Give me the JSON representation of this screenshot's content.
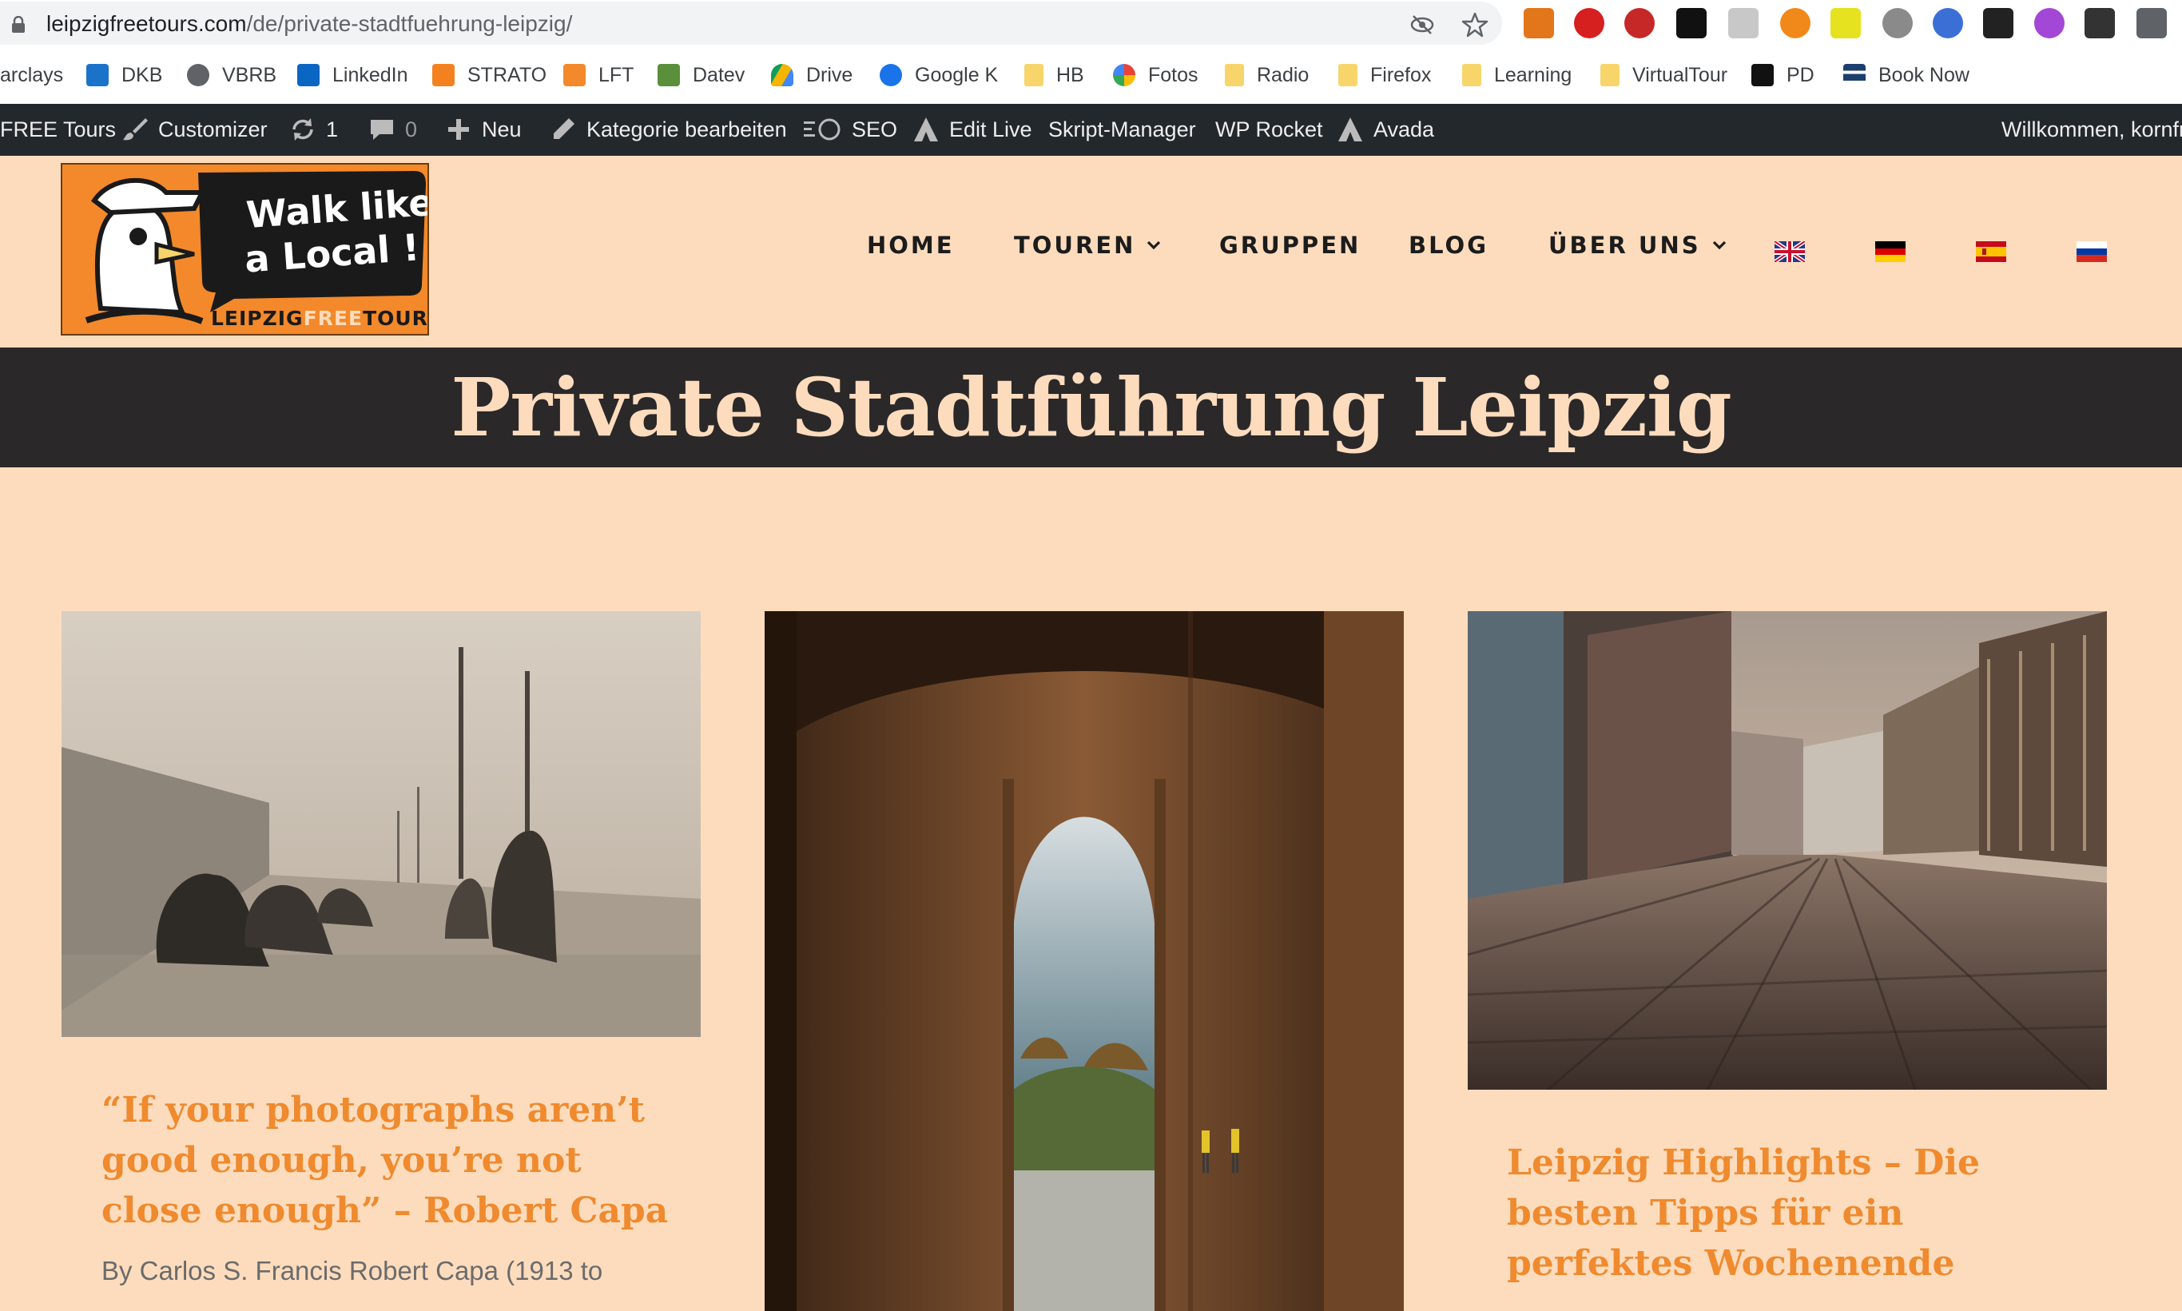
{
  "browser": {
    "url_domain": "leipzigfreetours.com",
    "url_path": "/de/private-stadtfuehrung-leipzig/"
  },
  "bookmarks": [
    {
      "label": "arclays",
      "icon": "barclays-icon"
    },
    {
      "label": "DKB",
      "icon": "dkb-icon"
    },
    {
      "label": "VBRB",
      "icon": "globe-icon"
    },
    {
      "label": "LinkedIn",
      "icon": "linkedin-icon"
    },
    {
      "label": "STRATO",
      "icon": "strato-icon"
    },
    {
      "label": "LFT",
      "icon": "lft-icon"
    },
    {
      "label": "Datev",
      "icon": "datev-icon"
    },
    {
      "label": "Drive",
      "icon": "drive-icon"
    },
    {
      "label": "Google K",
      "icon": "google-contacts-icon"
    },
    {
      "label": "HB",
      "icon": "folder-icon"
    },
    {
      "label": "Fotos",
      "icon": "photos-icon"
    },
    {
      "label": "Radio",
      "icon": "folder-icon"
    },
    {
      "label": "Firefox",
      "icon": "folder-icon"
    },
    {
      "label": "Learning",
      "icon": "folder-icon"
    },
    {
      "label": "VirtualTour",
      "icon": "folder-icon"
    },
    {
      "label": "PD",
      "icon": "pd-icon"
    },
    {
      "label": "Book Now",
      "icon": "booknow-icon"
    }
  ],
  "adminbar": {
    "site": "FREE Tours",
    "customizer": "Customizer",
    "updates": "1",
    "comments": "0",
    "new": "Neu",
    "edit_category": "Kategorie bearbeiten",
    "seo": "SEO",
    "edit_live": "Edit Live",
    "script_manager": "Skript-Manager",
    "wp_rocket": "WP Rocket",
    "avada": "Avada",
    "welcome": "Willkommen, kornfr"
  },
  "logo": {
    "slogan_line1": "Walk like",
    "slogan_line2": "a Local !",
    "brand_part1": "LEIPZIG",
    "brand_part2": "FREE",
    "brand_part3": "TOURS"
  },
  "nav": {
    "home": "HOME",
    "tours": "TOUREN",
    "groups": "GRUPPEN",
    "blog": "BLOG",
    "about": "ÜBER UNS"
  },
  "page": {
    "title": "Private Stadtführung Leipzig"
  },
  "cards": [
    {
      "title": "“If your photographs aren’t good enough, you’re not close enough” – Robert Capa",
      "excerpt": "By Carlos S. Francis   Robert Capa (1913 to"
    },
    {
      "title": "",
      "excerpt": ""
    },
    {
      "title": "Leipzig Highlights – Die besten Tipps für ein perfektes Wochenende",
      "excerpt": ""
    }
  ],
  "colors": {
    "page_bg": "#fddcbd",
    "accent": "#ef8a2e",
    "band_bg": "#2a2829",
    "admin_bg": "#23282d"
  }
}
